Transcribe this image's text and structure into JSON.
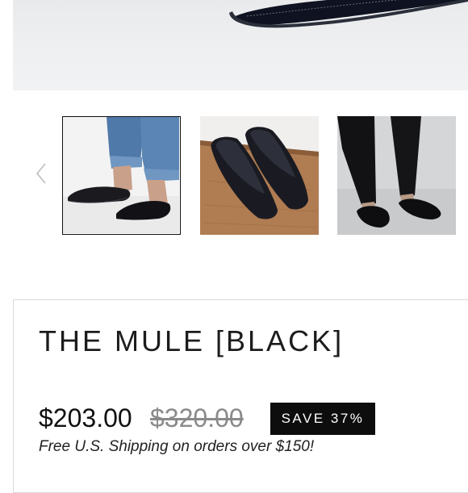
{
  "product": {
    "title": "THE MULE [BLACK]",
    "price": "$203.00",
    "compare_at_price": "$320.00",
    "save_badge": "SAVE 37%",
    "shipping_note": "Free U.S. Shipping on orders over $150!"
  },
  "gallery": {
    "thumbnails_visible": 3,
    "selected_index": 0,
    "icons": {
      "previous": "chevron-left-icon"
    }
  },
  "colors": {
    "badge_bg": "#0d0d0d",
    "compare_price": "#8a8a8a",
    "card_border": "#d9d9d9"
  }
}
